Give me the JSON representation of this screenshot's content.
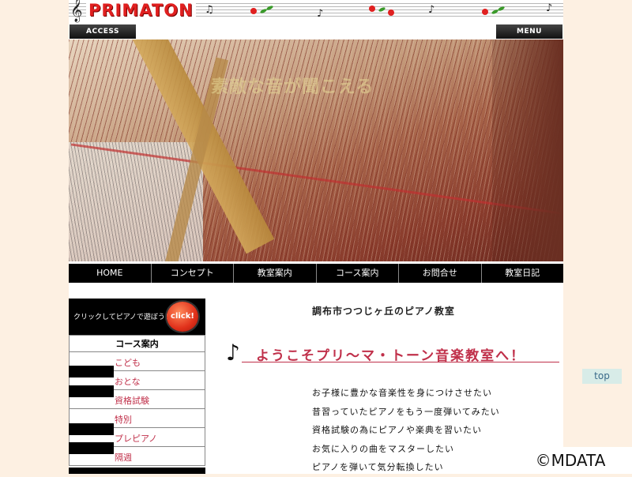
{
  "header": {
    "logo": "PRIMATON",
    "access_label": "ACCESS",
    "menu_label": "MENU"
  },
  "hero": {
    "tagline": "素敵な音が聞こえる"
  },
  "nav": {
    "items": [
      {
        "label": "HOME"
      },
      {
        "label": "コンセプト"
      },
      {
        "label": "教室案内"
      },
      {
        "label": "コース案内"
      },
      {
        "label": "お問合せ"
      },
      {
        "label": "教室日記"
      }
    ]
  },
  "sidebar": {
    "banner_text": "クリックしてピアノで遊ぼう！",
    "click_label": "click!",
    "heading": "コース案内",
    "items": [
      {
        "label": "こども"
      },
      {
        "label": "おとな"
      },
      {
        "label": "資格試験"
      },
      {
        "label": "特別"
      },
      {
        "label": "プレピアノ"
      },
      {
        "label": "隔週"
      }
    ]
  },
  "content": {
    "subtitle": "調布市つつじヶ丘のピアノ教室",
    "welcome_note": "♪",
    "welcome": "ようこそプリ～マ・トーン音楽教室へ！",
    "points": [
      "お子様に豊かな音楽性を身につけさせたい",
      "昔習っていたピアノをもう一度弾いてみたい",
      "資格試験の為にピアノや楽典を習いたい",
      "お気に入りの曲をマスターしたい",
      "ピアノを弾いて気分転換したい"
    ]
  },
  "top_button": "top",
  "watermark": "©MDATA",
  "colors": {
    "accent": "#c0304a",
    "logo_red": "#e02020",
    "page_bg": "#fdf0e2",
    "nav_bg": "#000000"
  }
}
